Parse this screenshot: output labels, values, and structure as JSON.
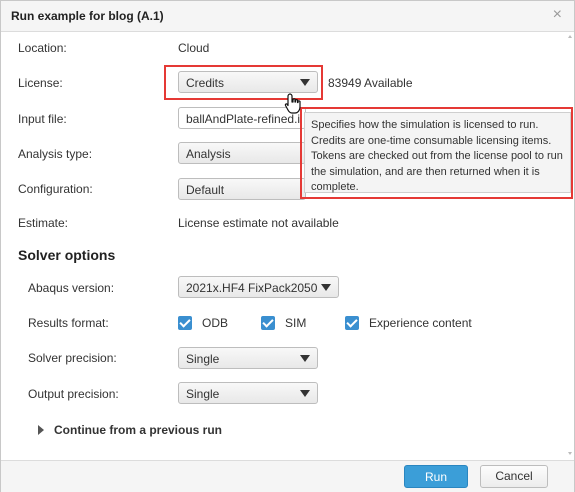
{
  "dialog": {
    "title": "Run example for blog (A.1)",
    "close_glyph": "×"
  },
  "fields": {
    "location": {
      "label": "Location:",
      "value": "Cloud"
    },
    "license": {
      "label": "License:",
      "selected": "Credits",
      "available": "83949 Available"
    },
    "input_file": {
      "label": "Input file:",
      "value": "ballAndPlate-refined.i"
    },
    "analysis_type": {
      "label": "Analysis type:",
      "selected": "Analysis"
    },
    "configuration": {
      "label": "Configuration:",
      "selected": "Default"
    },
    "estimate": {
      "label": "Estimate:",
      "value": "License estimate not available"
    }
  },
  "tooltip": {
    "text": "Specifies how the simulation is licensed to run. Credits are one-time consumable licensing items. Tokens are checked out from the license pool to run the simulation, and are then returned when it is complete."
  },
  "solver": {
    "heading": "Solver options",
    "abaqus_version": {
      "label": "Abaqus version:",
      "selected": "2021x.HF4 FixPack2050"
    },
    "results_format": {
      "label": "Results format:",
      "options": [
        {
          "label": "ODB",
          "checked": true
        },
        {
          "label": "SIM",
          "checked": true
        },
        {
          "label": "Experience content",
          "checked": true
        }
      ]
    },
    "solver_precision": {
      "label": "Solver precision:",
      "selected": "Single"
    },
    "output_precision": {
      "label": "Output precision:",
      "selected": "Single"
    },
    "continue_label": "Continue from a previous run"
  },
  "footer": {
    "run_label": "Run",
    "cancel_label": "Cancel"
  },
  "colors": {
    "accent": "#3b9ed8",
    "checkbox": "#3a8fd0",
    "highlight": "#e53935"
  }
}
